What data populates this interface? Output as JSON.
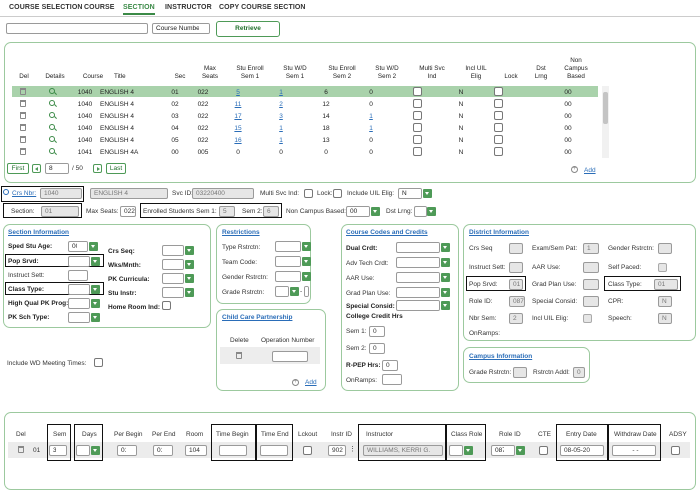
{
  "tabs": [
    "COURSE SELECTION",
    "COURSE",
    "SECTION",
    "INSTRUCTOR",
    "COPY COURSE SECTION"
  ],
  "search": {
    "value": "",
    "mode": "Course Number",
    "retrieve": "Retrieve"
  },
  "grid": {
    "headers": [
      "Del",
      "Details",
      "Course",
      "Title",
      "Sec",
      "Max Seats",
      "Stu Enroll Sem 1",
      "Stu W/D Sem 1",
      "Stu Enroll Sem 2",
      "Stu W/D Sem 2",
      "Multi Svc Ind",
      "Incl UIL Elig",
      "Lock",
      "Dst Lrng",
      "Non Campus Based"
    ],
    "rows": [
      [
        "1040",
        "ENGLISH 4",
        "01",
        "022",
        "5",
        "1",
        "6",
        "0",
        "N",
        "00"
      ],
      [
        "1040",
        "ENGLISH 4",
        "02",
        "022",
        "11",
        "2",
        "12",
        "0",
        "N",
        "00"
      ],
      [
        "1040",
        "ENGLISH 4",
        "03",
        "022",
        "17",
        "3",
        "14",
        "1",
        "N",
        "00"
      ],
      [
        "1040",
        "ENGLISH 4",
        "04",
        "022",
        "15",
        "1",
        "18",
        "1",
        "N",
        "00"
      ],
      [
        "1040",
        "ENGLISH 4",
        "05",
        "022",
        "16",
        "1",
        "13",
        "0",
        "N",
        "00"
      ],
      [
        "1041",
        "ENGLISH 4A",
        "00",
        "005",
        "0",
        "0",
        "0",
        "0",
        "N",
        "00"
      ]
    ],
    "first": "First",
    "page": "8",
    "of": "/ 50",
    "last": "Last",
    "add": "Add"
  },
  "detail": {
    "crs_nbr_label": "Crs Nbr:",
    "crs_nbr": "1040",
    "title": "ENGLISH 4",
    "svc_id_label": "Svc ID:",
    "svc_id": "03220400",
    "multi_svc_label": "Multi Svc Ind:",
    "lock_label": "Lock:",
    "uil_label": "Include UIL Elig:",
    "uil": "N",
    "section_label": "Section:",
    "section": "01",
    "max_seats_label": "Max Seats:",
    "max_seats": "022",
    "enrolled1_label": "Enrolled Students Sem 1:",
    "enrolled1": "5",
    "sem2_label": "Sem 2:",
    "sem2": "6",
    "non_campus_label": "Non Campus Based:",
    "non_campus": "00",
    "dst_lrng_label": "Dst Lrng:"
  },
  "section_info": {
    "title": "Section Information",
    "sped_label": "Sped Stu Age:",
    "sped": "00",
    "pop_label": "Pop Srvd:",
    "instruct_label": "Instruct Sett:",
    "class_type_label": "Class Type:",
    "hq_label": "High Qual PK Prog:",
    "pk_sch_label": "PK Sch Type:",
    "crs_seq_label": "Crs Seq:",
    "wks_label": "Wks/Mnth:",
    "pk_curr_label": "PK Curricula:",
    "stu_instr_label": "Stu Instr:",
    "home_room_label": "Home Room Ind:"
  },
  "restrictions": {
    "title": "Restrictions",
    "type_label": "Type Rstrctn:",
    "team_label": "Team Code:",
    "gender_label": "Gender Rstrctn:",
    "grade_label": "Grade Rstrctn:",
    "dash": "-"
  },
  "child_care": {
    "title": "Child Care Partnership",
    "delete": "Delete",
    "op_num": "Operation Number",
    "add": "Add"
  },
  "codes": {
    "title": "Course Codes and Credits",
    "dual_label": "Dual Crdt:",
    "adv_label": "Adv Tech Crdt:",
    "aar_label": "AAR Use:",
    "grad_label": "Grad Plan Use:",
    "special_label": "Special Consid:",
    "college_label": "College Credit Hrs",
    "sem1_label": "Sem 1:",
    "sem1": "0",
    "sem2_label": "Sem 2:",
    "sem2": "0",
    "rpep_label": "R-PEP Hrs:",
    "rpep": "0",
    "onramps_label": "OnRamps:"
  },
  "district": {
    "title": "District Information",
    "crs_seq": "Crs Seq",
    "exam": "Exam/Sem Pat:",
    "exam_val": "1",
    "gender": "Gender Rstrctn:",
    "instruct": "Instruct Sett:",
    "aar": "AAR Use:",
    "self_paced": "Self Paced:",
    "pop": "Pop Srvd:",
    "pop_val": "01",
    "grad": "Grad Plan Use:",
    "class_type": "Class Type:",
    "class_type_val": "01",
    "role": "Role ID:",
    "role_val": "087",
    "special": "Special Consid:",
    "cpr": "CPR:",
    "cpr_val": "N",
    "nbr_sem": "Nbr Sem:",
    "nbr_sem_val": "2",
    "uil": "Incl UIL Elig:",
    "speech": "Speech:",
    "speech_val": "N",
    "onramps": "OnRamps:"
  },
  "campus": {
    "title": "Campus Information",
    "grade": "Grade Rstrctn:",
    "addl": "Rstrctn Addl:",
    "addl_val": "0"
  },
  "wd_label": "Include WD Meeting Times:",
  "meeting": {
    "headers": [
      "Del",
      "Sem",
      "Days",
      "Per Begin",
      "Per End",
      "Room",
      "Time Begin",
      "Time End",
      "Lckout",
      "Instr ID",
      "Instructor",
      "Class Role",
      "Role ID",
      "CTE",
      "Entry Date",
      "Withdraw Date",
      "ADSY"
    ],
    "row": {
      "num": "01",
      "sem": "3",
      "days": "05",
      "per_begin": "01",
      "per_end": "01",
      "room": "104",
      "instr_id": "902",
      "instructor": "WILLIAMS, KERRI G.",
      "class_role": "01",
      "role_id": "087",
      "entry_date": "08-05-20",
      "withdraw_date": "- -"
    }
  }
}
